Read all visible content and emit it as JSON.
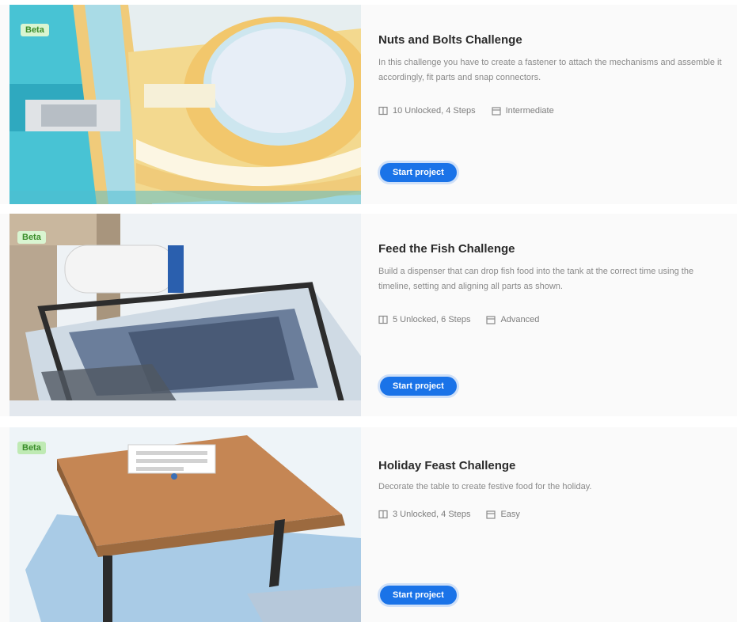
{
  "cards": [
    {
      "badge": "Beta",
      "title": "Nuts and Bolts Challenge",
      "description": "In this challenge you have to create a fastener to attach the mechanisms and assemble it accordingly, fit parts and snap connectors.",
      "meta": {
        "steps": "10 Unlocked, 4 Steps",
        "size": "Intermediate"
      },
      "button": "Start project",
      "icons": [
        "book-icon",
        "calendar-icon"
      ]
    },
    {
      "badge": "Beta",
      "title": "Feed the Fish Challenge",
      "description": "Build a dispenser that can drop fish food into the tank at the correct time using the timeline, setting and aligning all parts as shown.",
      "meta": {
        "steps": "5 Unlocked, 6 Steps",
        "size": "Advanced"
      },
      "button": "Start project",
      "icons": [
        "book-icon",
        "calendar-icon"
      ]
    },
    {
      "badge": "Beta",
      "title": "Holiday Feast Challenge",
      "description": "Decorate the table to create festive food for the holiday.",
      "meta": {
        "steps": "3 Unlocked, 4 Steps",
        "size": "Easy"
      },
      "button": "Start project",
      "icons": [
        "book-icon",
        "calendar-icon"
      ]
    }
  ],
  "colors": {
    "accent": "#1a73e8",
    "badge_bg": "#d9f5d1",
    "badge_text": "#3a8d2a"
  }
}
